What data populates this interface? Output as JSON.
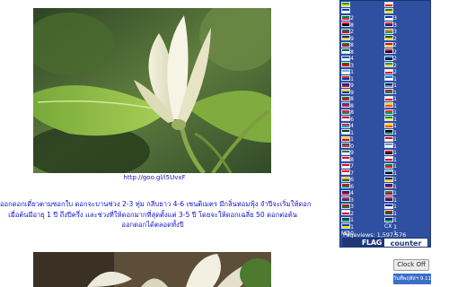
{
  "photo": {
    "caption": "http://goo.gl/i5UvxF"
  },
  "description": {
    "lines": [
      "ออกดอกเดี่ยวตามซอกใบ ดอกจะบานช่วง 2-3 ทุ่ม กลีบยาว 4-6 เซนติเมตร มีกลิ่นหอมฟุ้ง จำปีจะเริ่มให้ดอก",
      "เมื่อต้นมีอายุ 1 ปี ถึงปีครึ่ง และช่วงที่ให้ดอกมากที่สุดตั้งแต่ 3-5 ปี โดยจะให้ดอกเฉลี่ย 50 ดอกต่อต้น",
      "ออกดอกได้ตลอดทั้งปี"
    ]
  },
  "flag_counter": {
    "col1": [
      {
        "code": "BR",
        "count": "52",
        "colors": [
          "#009c3b",
          "#ffdf00"
        ]
      },
      {
        "code": "SV",
        "count": "48",
        "colors": [
          "#0f47af",
          "#ffffff"
        ]
      },
      {
        "code": "ZA",
        "count": "42",
        "colors": [
          "#007a4d",
          "#de3831"
        ]
      },
      {
        "code": "EG",
        "count": "39",
        "colors": [
          "#ce1126",
          "#000000"
        ]
      },
      {
        "code": "MX",
        "count": "38",
        "colors": [
          "#006847",
          "#ce1126"
        ]
      },
      {
        "code": "RO",
        "count": "38",
        "colors": [
          "#002b7f",
          "#fcd116"
        ]
      },
      {
        "code": "KW",
        "count": "34",
        "colors": [
          "#007a3d",
          "#ce1126"
        ]
      },
      {
        "code": "SA",
        "count": "33",
        "colors": [
          "#006c35",
          "#ffffff"
        ]
      },
      {
        "code": "GR",
        "count": "31",
        "colors": [
          "#0d5eaf",
          "#ffffff"
        ]
      },
      {
        "code": "PT",
        "count": "31",
        "colors": [
          "#006600",
          "#ff0000"
        ]
      },
      {
        "code": "AR",
        "count": "29",
        "colors": [
          "#74acdf",
          "#ffffff"
        ]
      },
      {
        "code": "CL",
        "count": "29",
        "colors": [
          "#d52b1e",
          "#0039a6"
        ]
      },
      {
        "code": "NZ",
        "count": "28",
        "colors": [
          "#00247d",
          "#cc142b"
        ]
      },
      {
        "code": "CO",
        "count": "28",
        "colors": [
          "#fcd116",
          "#003893"
        ]
      },
      {
        "code": "AE",
        "count": "28",
        "colors": [
          "#00732f",
          "#ff0000"
        ]
      },
      {
        "code": "SK",
        "count": "26",
        "colors": [
          "#0b4ea2",
          "#ee1c25"
        ]
      },
      {
        "code": "HU",
        "count": "24",
        "colors": [
          "#cd2a3e",
          "#436f4d"
        ]
      },
      {
        "code": "DK",
        "count": "21",
        "colors": [
          "#c60c30",
          "#ffffff"
        ]
      },
      {
        "code": "LU",
        "count": "21",
        "colors": [
          "#ed2939",
          "#00a1de"
        ]
      },
      {
        "code": "PK",
        "count": "20",
        "colors": [
          "#01411c",
          "#ffffff"
        ]
      },
      {
        "code": "CO",
        "count": "19",
        "colors": [
          "#fcd116",
          "#ce1126"
        ]
      },
      {
        "code": "BD",
        "count": "18",
        "colors": [
          "#006a4e",
          "#f42a41"
        ]
      },
      {
        "code": "MO",
        "count": "17",
        "colors": [
          "#00785e",
          "#ffffff"
        ]
      },
      {
        "code": "PE",
        "count": "17",
        "colors": [
          "#d91023",
          "#ffffff"
        ]
      },
      {
        "code": "BH",
        "count": "16",
        "colors": [
          "#ce1126",
          "#ffffff"
        ]
      },
      {
        "code": "CA",
        "count": "16",
        "colors": [
          "#ff0000",
          "#ffffff"
        ]
      },
      {
        "code": "LT",
        "count": "14",
        "colors": [
          "#fdb913",
          "#006a44"
        ]
      },
      {
        "code": "IQ",
        "count": "13",
        "colors": [
          "#ce1126",
          "#007a3d"
        ]
      },
      {
        "code": "KH",
        "count": "13",
        "colors": [
          "#032ea1",
          "#e00025"
        ]
      },
      {
        "code": "RS",
        "count": "12",
        "colors": [
          "#c6363c",
          "#0c4076"
        ]
      },
      {
        "code": "BY",
        "count": "11",
        "colors": [
          "#cf101a",
          "#007c30"
        ]
      },
      {
        "code": "MT",
        "count": "11",
        "colors": [
          "#ffffff",
          "#cf142b"
        ]
      },
      {
        "code": "NA",
        "count": "10",
        "colors": [
          "#003580",
          "#009543"
        ]
      },
      {
        "code": "MD",
        "count": "10",
        "colors": [
          "#0046ae",
          "#ffd200"
        ]
      }
    ],
    "col2": [
      {
        "code": "GE",
        "count": "3",
        "colors": [
          "#ffffff",
          "#ff0000"
        ]
      },
      {
        "code": "ET",
        "count": "3",
        "colors": [
          "#078930",
          "#fcdd09"
        ]
      },
      {
        "code": "UY",
        "count": "3",
        "colors": [
          "#0038a8",
          "#ffffff"
        ]
      },
      {
        "code": "MU",
        "count": "2",
        "colors": [
          "#ea2839",
          "#1a206d"
        ]
      },
      {
        "code": "CI",
        "count": "2",
        "colors": [
          "#f77f00",
          "#009e60"
        ]
      },
      {
        "code": "ZW",
        "count": "2",
        "colors": [
          "#006400",
          "#ffd200"
        ]
      },
      {
        "code": "GH",
        "count": "2",
        "colors": [
          "#ce1126",
          "#fcd116"
        ]
      },
      {
        "code": "YE",
        "count": "2",
        "colors": [
          "#ce1126",
          "#000000"
        ]
      },
      {
        "code": "EE",
        "count": "2",
        "colors": [
          "#0072ce",
          "#000000"
        ]
      },
      {
        "code": "GA",
        "count": "1",
        "colors": [
          "#009e60",
          "#fcd116"
        ]
      },
      {
        "code": "GI",
        "count": "1",
        "colors": [
          "#ffffff",
          "#da000c"
        ]
      },
      {
        "code": "HN",
        "count": "1",
        "colors": [
          "#0073cf",
          "#ffffff"
        ]
      },
      {
        "code": "TV",
        "count": "1",
        "colors": [
          "#00247d",
          "#5b97b1"
        ]
      },
      {
        "code": "MV",
        "count": "1",
        "colors": [
          "#d21034",
          "#007e3a"
        ]
      },
      {
        "code": "JE",
        "count": "1",
        "colors": [
          "#ffffff",
          "#e8112d"
        ]
      },
      {
        "code": "BT",
        "count": "1",
        "colors": [
          "#ffd520",
          "#ff4e12"
        ]
      },
      {
        "code": "BF",
        "count": "1",
        "colors": [
          "#ef2b2d",
          "#009e49"
        ]
      },
      {
        "code": "SN",
        "count": "1",
        "colors": [
          "#00853f",
          "#fdef42"
        ]
      },
      {
        "code": "BT",
        "count": "1",
        "colors": [
          "#ffd520",
          "#ff4e12"
        ]
      },
      {
        "code": "PS",
        "count": "1",
        "colors": [
          "#000000",
          "#007a3d"
        ]
      },
      {
        "code": "CT",
        "count": "1",
        "colors": [
          "#ff0000",
          "#ffffff"
        ]
      },
      {
        "code": "FM",
        "count": "1",
        "colors": [
          "#6797d6",
          "#ffffff"
        ]
      },
      {
        "code": "TT",
        "count": "1",
        "colors": [
          "#ce1126",
          "#000000"
        ]
      },
      {
        "code": "PA",
        "count": "1",
        "colors": [
          "#ffffff",
          "#d21034"
        ]
      },
      {
        "code": "SN",
        "count": "1",
        "colors": [
          "#00853f",
          "#e31b23"
        ]
      },
      {
        "code": "BW",
        "count": "1",
        "colors": [
          "#75aadb",
          "#000000"
        ]
      },
      {
        "code": "TD",
        "count": "1",
        "colors": [
          "#002664",
          "#fecb00"
        ]
      },
      {
        "code": "HT",
        "count": "1",
        "colors": [
          "#00209f",
          "#d21034"
        ]
      },
      {
        "code": "SR",
        "count": "1",
        "colors": [
          "#377e3f",
          "#b40a2d"
        ]
      },
      {
        "code": "BM",
        "count": "1",
        "colors": [
          "#cf142b",
          "#00247d"
        ]
      },
      {
        "code": "CK",
        "count": "1",
        "colors": [
          "#00247d",
          "#ffffff"
        ]
      },
      {
        "code": "TJ",
        "count": "1",
        "colors": [
          "#cc0000",
          "#006600"
        ]
      },
      {
        "code": "CX",
        "count": "1",
        "colors": [
          "#0021ad",
          "#1c8a42"
        ]
      }
    ],
    "pageviews": "Pageviews: 1,597,576",
    "logo_left": "FLAG",
    "logo_right": "counter"
  },
  "clock": {
    "button_label": "Clock Off",
    "display": "วันที่พฤหัสฯ 9.11.53"
  }
}
